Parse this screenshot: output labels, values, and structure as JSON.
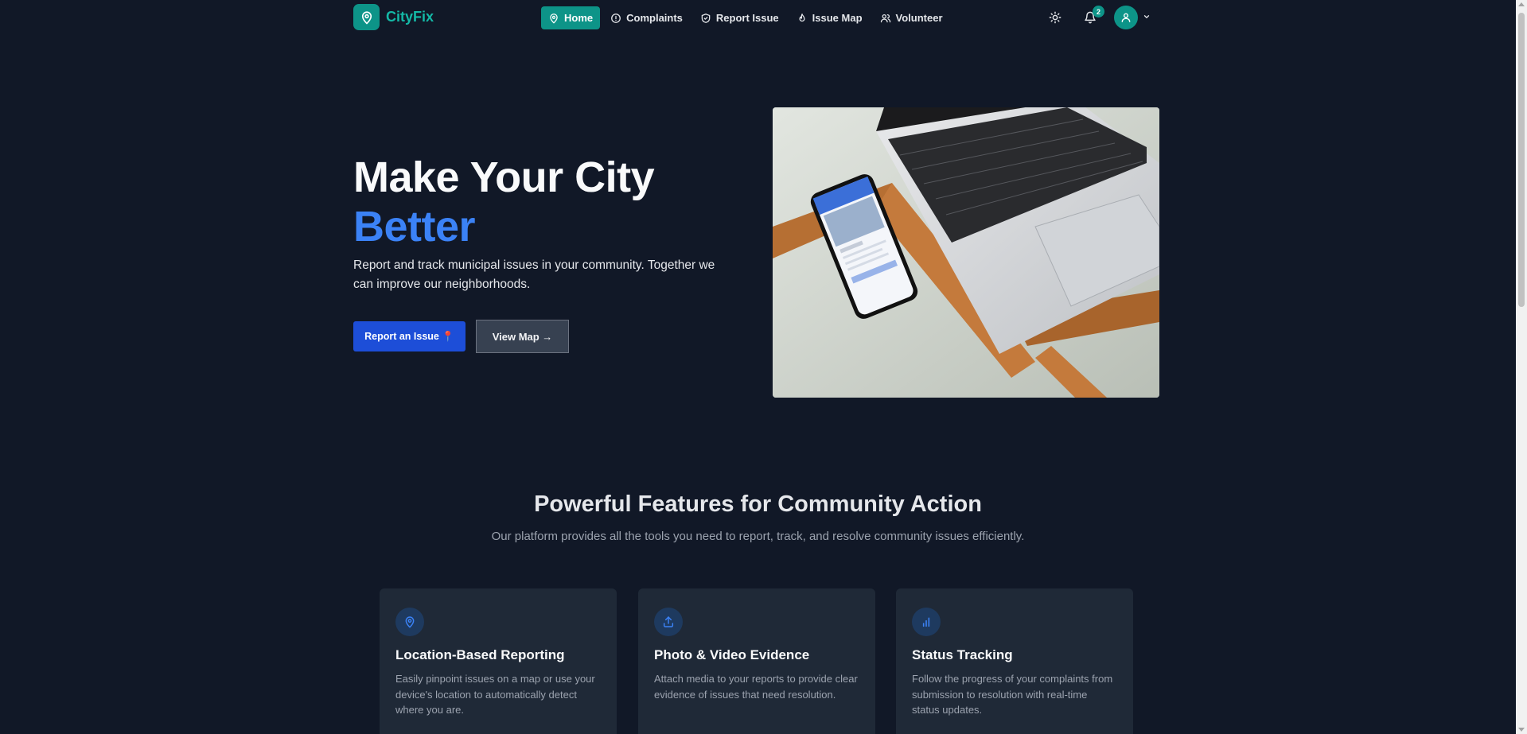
{
  "brand": {
    "name": "CityFix",
    "logo_icon": "map-pin-icon",
    "color": "#14b8a6"
  },
  "nav": {
    "items": [
      {
        "label": "Home",
        "icon": "map-pin-icon",
        "active": true
      },
      {
        "label": "Complaints",
        "icon": "alert-circle-icon",
        "active": false
      },
      {
        "label": "Report Issue",
        "icon": "shield-check-icon",
        "active": false
      },
      {
        "label": "Issue Map",
        "icon": "flame-icon",
        "active": false
      },
      {
        "label": "Volunteer",
        "icon": "users-icon",
        "active": false
      }
    ],
    "notifications_count": "2",
    "theme_icon": "sun-icon",
    "bell_icon": "bell-icon",
    "avatar_icon": "user-icon"
  },
  "hero": {
    "title_line1": "Make Your City",
    "title_line2": "Better",
    "subtitle": "Report and track municipal issues in your community. Together we can improve our neighborhoods.",
    "primary_button": "Report an Issue 📍",
    "secondary_button": "View Map →",
    "image_description_icon": "laptop-phone-photo"
  },
  "features": {
    "title": "Powerful Features for Community Action",
    "subtitle": "Our platform provides all the tools you need to report, track, and resolve community issues efficiently.",
    "cards": [
      {
        "icon": "map-pin-icon",
        "title": "Location-Based Reporting",
        "description": "Easily pinpoint issues on a map or use your device's location to automatically detect where you are."
      },
      {
        "icon": "upload-icon",
        "title": "Photo & Video Evidence",
        "description": "Attach media to your reports to provide clear evidence of issues that need resolution."
      },
      {
        "icon": "bar-chart-icon",
        "title": "Status Tracking",
        "description": "Follow the progress of your complaints from submission to resolution with real-time status updates."
      }
    ]
  },
  "colors": {
    "background": "#111827",
    "accent_teal": "#0d9488",
    "accent_blue": "#3b82f6",
    "primary_button": "#1d4ed8",
    "card_bg": "#1f2937"
  }
}
